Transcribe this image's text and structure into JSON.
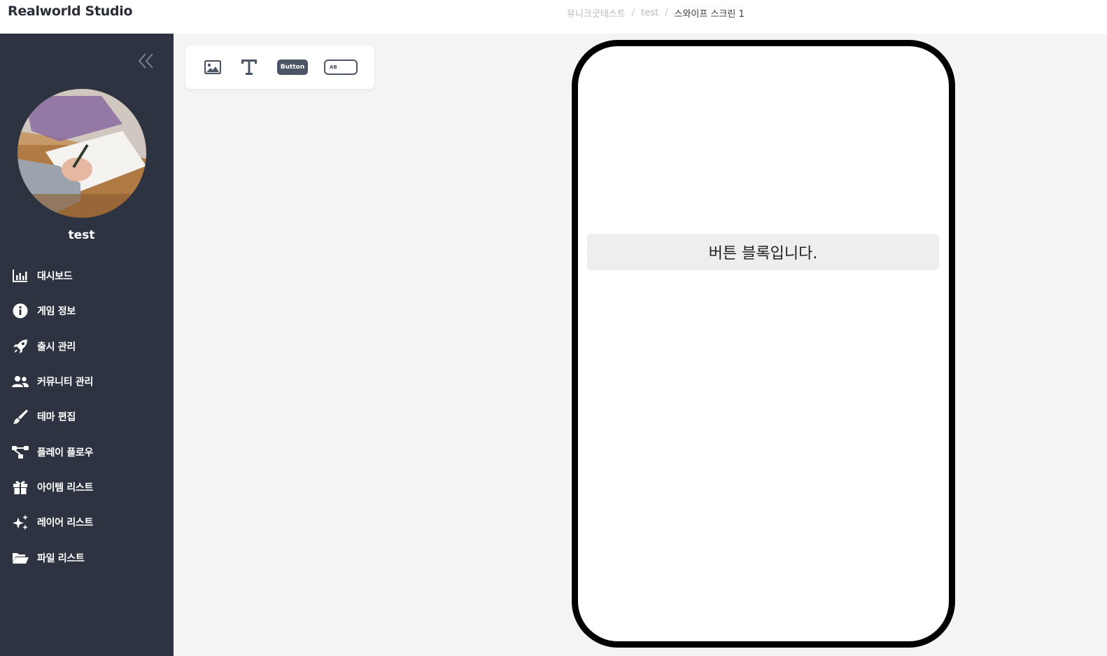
{
  "header": {
    "brand": "Realworld Studio",
    "breadcrumb": [
      "유니크굿테스트",
      "test",
      "스와이프 스크린 1"
    ],
    "separator": "/"
  },
  "sidebar": {
    "collapse_icon": "double-chevron-left-icon",
    "profile": {
      "name": "test",
      "avatar": "photo of hand writing with pencil"
    },
    "items": [
      {
        "label": "대시보드",
        "icon": "chart-bar-icon"
      },
      {
        "label": "게임 정보",
        "icon": "info-circle-icon"
      },
      {
        "label": "출시 관리",
        "icon": "rocket-icon"
      },
      {
        "label": "커뮤니티 관리",
        "icon": "users-icon"
      },
      {
        "label": "테마 편집",
        "icon": "paintbrush-icon"
      },
      {
        "label": "플레이 플로우",
        "icon": "flow-diagram-icon"
      },
      {
        "label": "아이템 리스트",
        "icon": "gift-icon"
      },
      {
        "label": "레이어 리스트",
        "icon": "sparkles-icon"
      },
      {
        "label": "파일 리스트",
        "icon": "folder-open-icon"
      }
    ],
    "background": "#2d3340"
  },
  "toolbox": {
    "tools": [
      {
        "name": "image-tool",
        "icon": "image-icon"
      },
      {
        "name": "text-tool",
        "icon": "text-icon"
      },
      {
        "name": "button-tool",
        "label": "Button"
      },
      {
        "name": "input-tool",
        "label": "AB"
      }
    ]
  },
  "canvas": {
    "button_block_text": "버튼 블록입니다."
  }
}
